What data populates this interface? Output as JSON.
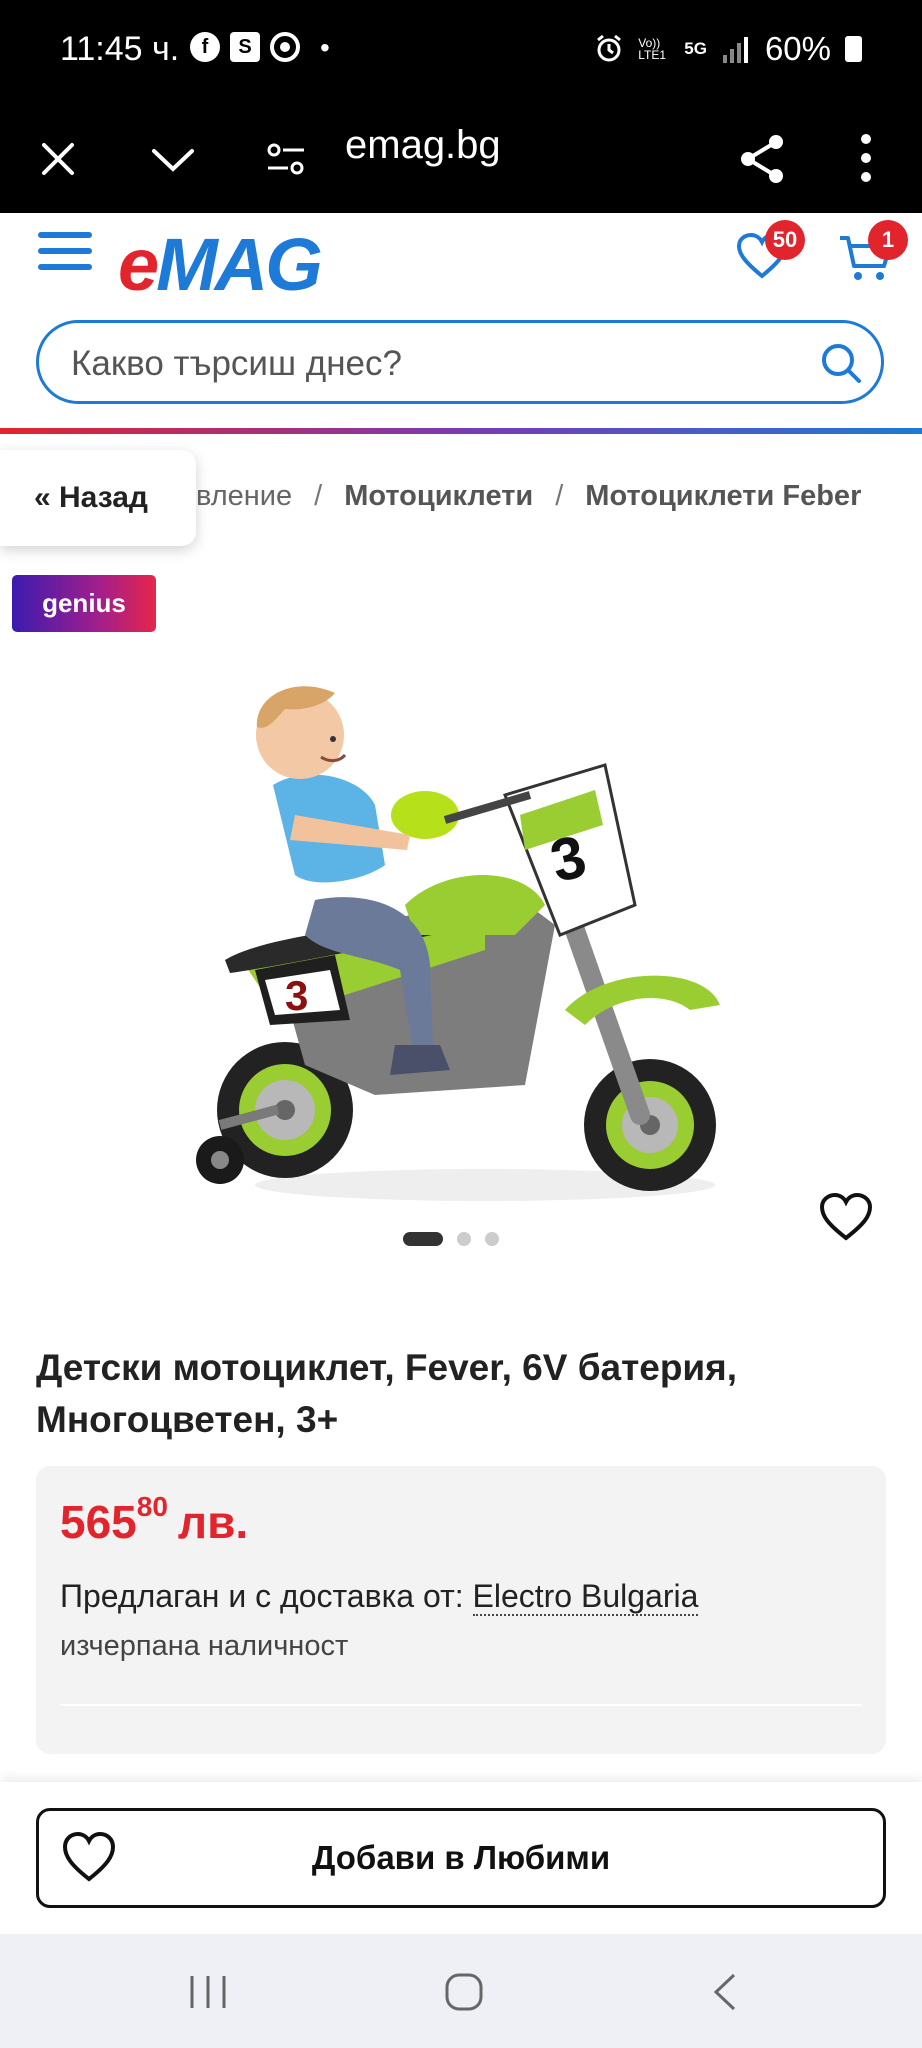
{
  "status_bar": {
    "time": "11:45 ч.",
    "icons_left": [
      "facebook-icon",
      "s-app-icon",
      "camera-app-icon"
    ],
    "dot": "•",
    "icons_right": [
      "alarm-icon",
      "volte-icon",
      "5g-icon",
      "signal-icon",
      "battery-icon"
    ],
    "volte_label": "Vo)) LTE1",
    "net_label": "5G",
    "battery": "60%"
  },
  "browser_bar": {
    "url": "emag.bg",
    "icons": [
      "close-icon",
      "chevron-down-icon",
      "site-settings-icon",
      "share-icon",
      "more-vertical-icon"
    ]
  },
  "header": {
    "logo_e": "e",
    "logo_mag": "MAG",
    "favorites_count": "50",
    "cart_count": "1"
  },
  "search": {
    "placeholder": "Какво търсиш днес?"
  },
  "breadcrumb": {
    "back_label": "« Назад",
    "partial": "вление",
    "sep": "/",
    "item1": "Мотоциклети",
    "item2": "Мотоциклети Feber"
  },
  "genius_label": "genius",
  "gallery": {
    "image_count": 3,
    "active_index": 0,
    "plate_front": "3",
    "plate_side": "3"
  },
  "product": {
    "title": "Детски мотоциклет, Fever, 6V батерия, Многоцветен, 3+",
    "price_main": "565",
    "price_cents": "80",
    "price_currency": "лв.",
    "seller_prefix": "Предлаган и с доставка от: ",
    "seller_name": "Electro Bulgaria",
    "availability": "изчерпана наличност"
  },
  "actions": {
    "add_favorites": "Добави в Любими"
  },
  "colors": {
    "brand_red": "#e2242d",
    "brand_blue": "#1d7ad6"
  }
}
